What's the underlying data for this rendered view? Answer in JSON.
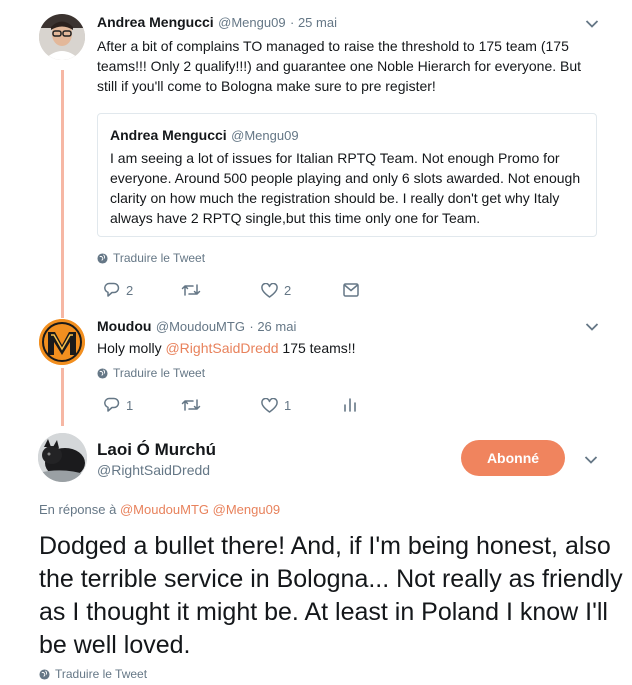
{
  "tweet1": {
    "author_name": "Andrea Mengucci",
    "handle": "@Mengu09",
    "date": "· 25 mai",
    "text": "After a bit of complains TO managed to raise the threshold to 175 team (175 teams!!! Only 2 qualify!!!) and guarantee one Noble Hierarch for everyone. But still if you'll come to Bologna make sure to pre register!",
    "quote": {
      "author_name": "Andrea Mengucci",
      "handle": "@Mengu09",
      "text": "I am seeing a lot of issues for Italian RPTQ Team. Not enough Promo for everyone. Around 500 people playing and only 6 slots awarded. Not enough clarity on how much the registration should be. I really don't get why Italy always have 2 RPTQ single,but this time only one for Team."
    },
    "translate": "Traduire le Tweet",
    "reply_count": "2",
    "like_count": "2"
  },
  "tweet2": {
    "author_name": "Moudou",
    "handle": "@MoudouMTG",
    "date": "· 26 mai",
    "text_before": "Holy molly ",
    "mention": "@RightSaidDredd",
    "text_after": " 175 teams!!",
    "translate": "Traduire le Tweet",
    "reply_count": "1",
    "like_count": "1"
  },
  "main": {
    "author_name": "Laoi Ó Murchú",
    "handle": "@RightSaidDredd",
    "follow_label": "Abonné",
    "reply_prefix": "En réponse à",
    "reply_to_1": "@MoudouMTG",
    "reply_to_2": "@Mengu09",
    "text": "Dodged a bullet there! And, if I'm being honest, also the terrible service in Bologna... Not really as friendly as I thought it might be. At least in Poland I know I'll be well loved.",
    "translate": "Traduire le Tweet"
  },
  "colors": {
    "accent": "#f0845e",
    "mention": "#e8825c",
    "thread_line": "#f6b7a4",
    "muted": "#657786"
  },
  "icons": [
    "chevron-down-icon",
    "globe-icon",
    "reply-icon",
    "retweet-icon",
    "like-icon",
    "message-icon",
    "analytics-icon"
  ]
}
